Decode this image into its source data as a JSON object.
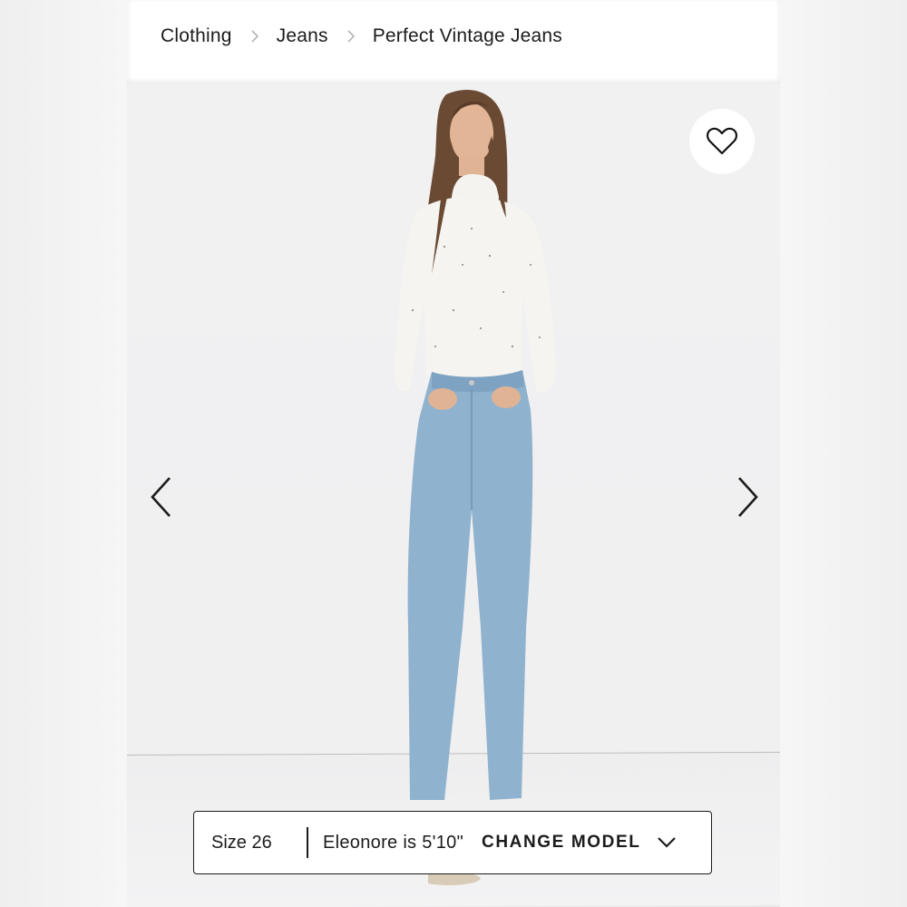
{
  "breadcrumb": {
    "items": [
      {
        "label": "Clothing"
      },
      {
        "label": "Jeans"
      },
      {
        "label": "Perfect Vintage Jeans"
      }
    ],
    "separator_icon": "chevron-right-icon"
  },
  "gallery": {
    "favorite_icon": "heart-outline-icon",
    "prev_icon": "chevron-left-icon",
    "next_icon": "chevron-right-icon"
  },
  "model_info": {
    "size_label": "Size 26",
    "model_height": "Eleonore is 5'10\"",
    "change_model_label": "CHANGE MODEL",
    "dropdown_icon": "chevron-down-icon"
  },
  "colors": {
    "text": "#1b1b1b",
    "background": "#ffffff",
    "photo_background": "#f0f0f1",
    "denim": "#8fb2cf"
  }
}
